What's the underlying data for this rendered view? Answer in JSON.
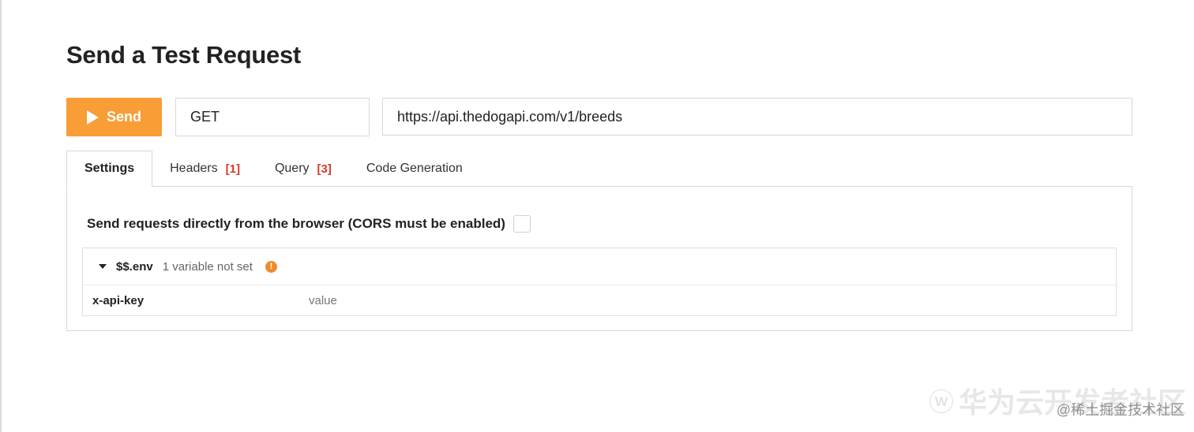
{
  "page": {
    "title": "Send a Test Request"
  },
  "request": {
    "send_label": "Send",
    "method": "GET",
    "url": "https://api.thedogapi.com/v1/breeds"
  },
  "tabs": [
    {
      "label": "Settings",
      "count": ""
    },
    {
      "label": "Headers",
      "count": "[1]"
    },
    {
      "label": "Query",
      "count": "[3]"
    },
    {
      "label": "Code Generation",
      "count": ""
    }
  ],
  "settings": {
    "cors_label": "Send requests directly from the browser (CORS must be enabled)",
    "cors_checked": false
  },
  "env": {
    "name": "$$.env",
    "status": "1 variable not set",
    "warning_icon": "!",
    "variables": [
      {
        "key": "x-api-key",
        "placeholder": "value"
      }
    ]
  },
  "watermark": {
    "brand": "华为云开发者社区",
    "sub": "@稀土掘金技术社区"
  },
  "colors": {
    "accent": "#f99d36",
    "count": "#d9382c",
    "warning": "#f08a2a"
  }
}
